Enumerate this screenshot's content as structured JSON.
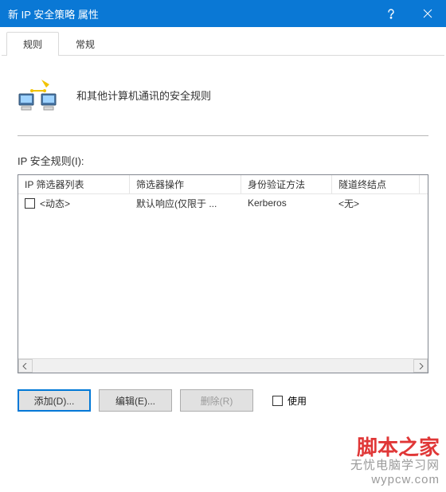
{
  "titlebar": {
    "title": "新 IP 安全策略 属性"
  },
  "tabs": {
    "rules": "规则",
    "general": "常规"
  },
  "intro": {
    "text": "和其他计算机通讯的安全规则"
  },
  "rules_section": {
    "label": "IP 安全规则(I):"
  },
  "columns": {
    "filter_list": "IP 筛选器列表",
    "filter_action": "筛选器操作",
    "auth_method": "身份验证方法",
    "tunnel_endpoint": "隧道终结点"
  },
  "rows": [
    {
      "checked": false,
      "filter_list": "<动态>",
      "filter_action": "默认响应(仅限于 ...",
      "auth_method": "Kerberos",
      "tunnel_endpoint": "<无>"
    }
  ],
  "buttons": {
    "add": "添加(D)...",
    "edit": "编辑(E)...",
    "delete": "删除(R)",
    "use_wizard": "使用"
  },
  "watermark": {
    "red": "脚本之家",
    "grey": "无忧电脑学习网",
    "url": "wypcw.com"
  },
  "column_widths": {
    "filter_list": 140,
    "filter_action": 140,
    "auth_method": 114,
    "tunnel_endpoint": 110
  }
}
